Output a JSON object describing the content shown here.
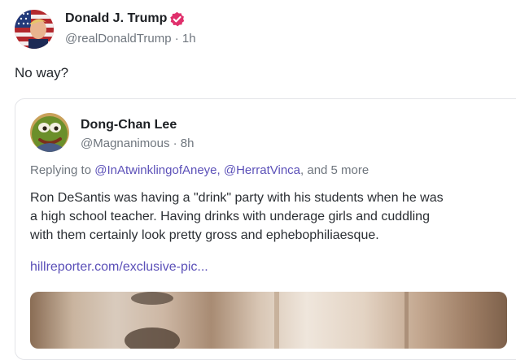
{
  "post": {
    "author_name": "Donald J. Trump",
    "handle": "@realDonaldTrump",
    "time": "1h",
    "text": "No way?",
    "verified_icon": "verified-check-icon",
    "avatar_icon": "flag-portrait-avatar"
  },
  "quoted": {
    "author_name": "Dong-Chan Lee",
    "handle": "@Magnanimous",
    "time": "8h",
    "replying_prefix": "Replying to",
    "replying_users": "@InAtwinklingofAneye, @HerratVinca",
    "replying_suffix": ", and 5 more",
    "text_lines": [
      "Ron DeSantis was having a \"drink\" party with his students when he was",
      "a high school teacher. Having drinks with underage girls and cuddling",
      "with them certainly look pretty gross and ephebophiliaesque."
    ],
    "link": "hillreporter.com/exclusive-pic...",
    "avatar_icon": "frog-cartoon-avatar",
    "media_icon": "photo-thumbnail"
  },
  "separator": " · ",
  "colors": {
    "verified": "#e0306c",
    "link": "#5b50b8",
    "muted": "#6f767e"
  }
}
